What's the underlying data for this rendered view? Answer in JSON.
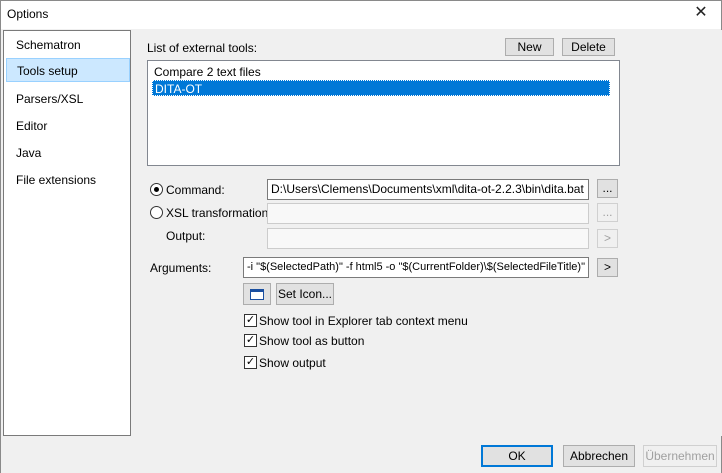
{
  "window": {
    "title": "Options",
    "close_glyph": "✕"
  },
  "sidebar": {
    "items": [
      {
        "label": "Schematron"
      },
      {
        "label": "Tools setup"
      },
      {
        "label": "Parsers/XSL"
      },
      {
        "label": "Editor"
      },
      {
        "label": "Java"
      },
      {
        "label": "File extensions"
      }
    ],
    "selected_index": 1
  },
  "tools": {
    "list_label": "List of external tools:",
    "new_label": "New",
    "delete_label": "Delete",
    "items": [
      "Compare 2 text files",
      "DITA-OT"
    ],
    "selected_index": 1
  },
  "form": {
    "command_label": "Command:",
    "command_value": "D:\\Users\\Clemens\\Documents\\xml\\dita-ot-2.2.3\\bin\\dita.bat",
    "command_browse": "...",
    "xsl_label": "XSL transformation:",
    "xsl_value": "",
    "xsl_browse": "...",
    "output_label": "Output:",
    "output_value": "",
    "output_arrow": ">",
    "arguments_label": "Arguments:",
    "arguments_value": "-i \"$(SelectedPath)\" -f html5 -o \"$(CurrentFolder)\\$(SelectedFileTitle)\"",
    "arguments_arrow": ">",
    "set_icon_label": "Set Icon...",
    "checks": [
      {
        "label": "Show tool in Explorer tab context menu",
        "checked": true
      },
      {
        "label": "Show tool as button",
        "checked": true
      },
      {
        "label": "Show output",
        "checked": true
      }
    ],
    "check_glyph": "✓"
  },
  "footer": {
    "ok_label": "OK",
    "cancel_label": "Abbrechen",
    "apply_label": "Übernehmen"
  }
}
